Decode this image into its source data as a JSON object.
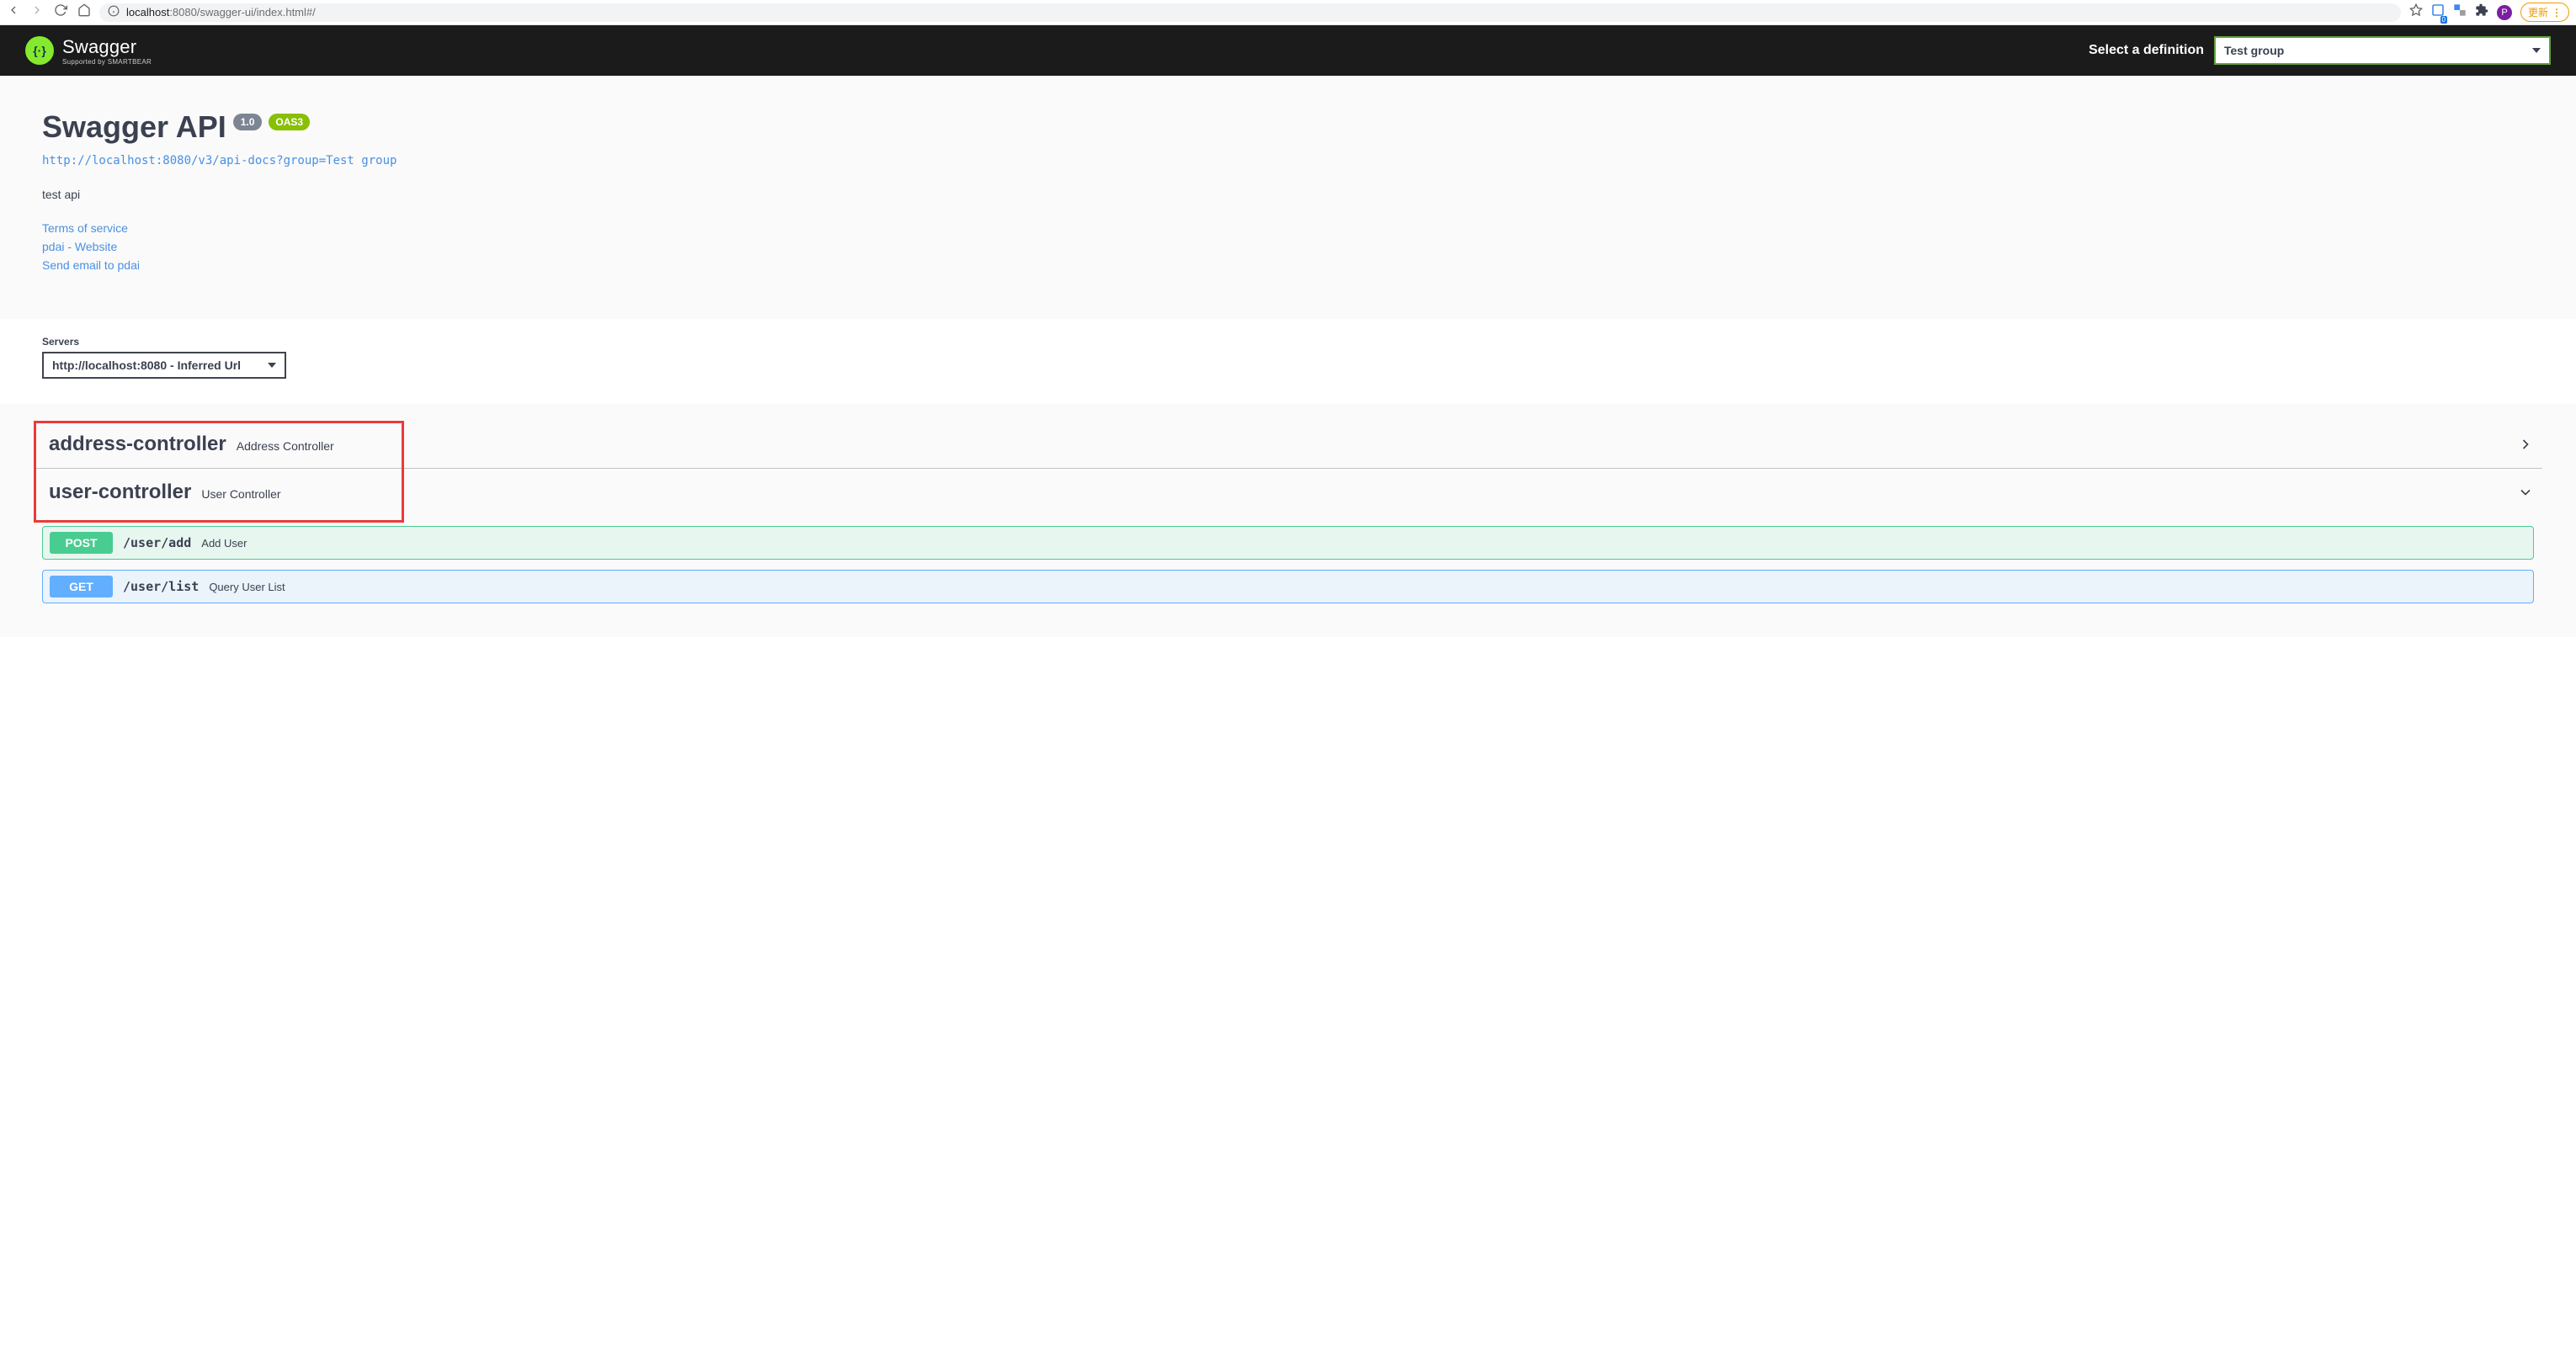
{
  "browser": {
    "url_host": "localhost",
    "url_rest": ":8080/swagger-ui/index.html#/",
    "update_label": "更新",
    "avatar_letter": "P",
    "translate_badge": "0"
  },
  "topbar": {
    "logo_main": "Swagger",
    "logo_sub": "Supported by SMARTBEAR",
    "select_label": "Select a definition",
    "definition_value": "Test group"
  },
  "info": {
    "title": "Swagger API",
    "version": "1.0",
    "oas": "OAS3",
    "spec_url": "http://localhost:8080/v3/api-docs?group=Test group",
    "description": "test api",
    "links": {
      "terms": "Terms of service",
      "website": "pdai - Website",
      "email": "Send email to pdai"
    }
  },
  "servers": {
    "label": "Servers",
    "selected": "http://localhost:8080 - Inferred Url"
  },
  "tags": [
    {
      "name": "address-controller",
      "desc": "Address Controller",
      "expanded": false
    },
    {
      "name": "user-controller",
      "desc": "User Controller",
      "expanded": true
    }
  ],
  "operations": [
    {
      "method": "POST",
      "method_class": "post",
      "path": "/user/add",
      "summary": "Add User"
    },
    {
      "method": "GET",
      "method_class": "get",
      "path": "/user/list",
      "summary": "Query User List"
    }
  ]
}
